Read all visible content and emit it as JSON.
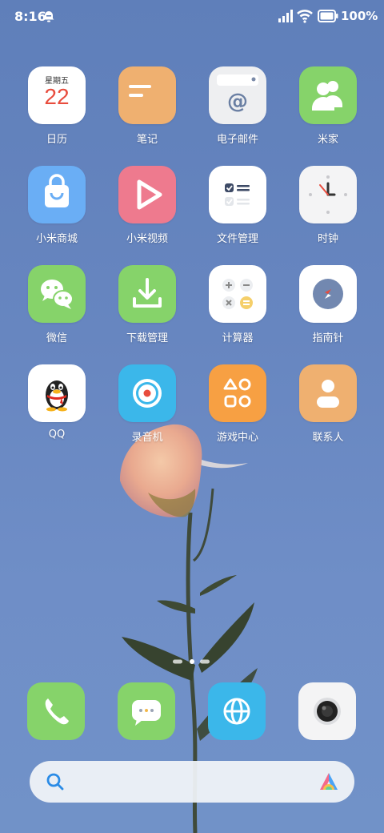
{
  "status_bar": {
    "time": "8:16",
    "battery": "100%",
    "battery_level": 1.0
  },
  "apps": [
    {
      "label": "日历",
      "icon": "calendar-icon",
      "weekday": "星期五",
      "day": "22"
    },
    {
      "label": "笔记",
      "icon": "notes-icon"
    },
    {
      "label": "电子邮件",
      "icon": "email-icon"
    },
    {
      "label": "米家",
      "icon": "mijia-icon"
    },
    {
      "label": "小米商城",
      "icon": "shopping-bag-icon"
    },
    {
      "label": "小米视频",
      "icon": "play-icon"
    },
    {
      "label": "文件管理",
      "icon": "file-manager-icon"
    },
    {
      "label": "时钟",
      "icon": "clock-icon"
    },
    {
      "label": "微信",
      "icon": "wechat-icon"
    },
    {
      "label": "下载管理",
      "icon": "download-icon"
    },
    {
      "label": "计算器",
      "icon": "calculator-icon"
    },
    {
      "label": "指南针",
      "icon": "compass-icon"
    },
    {
      "label": "QQ",
      "icon": "qq-penguin-icon"
    },
    {
      "label": "录音机",
      "icon": "recorder-icon"
    },
    {
      "label": "游戏中心",
      "icon": "game-center-icon"
    },
    {
      "label": "联系人",
      "icon": "contacts-icon"
    }
  ],
  "page_indicator": {
    "pages": 3,
    "current": 2
  },
  "dock": [
    {
      "icon": "phone-icon"
    },
    {
      "icon": "messages-icon"
    },
    {
      "icon": "browser-icon"
    },
    {
      "icon": "camera-icon"
    }
  ],
  "search_bar": {
    "icon": "search-icon",
    "assistant_icon": "assistant-icon"
  },
  "colors": {
    "wallpaper": "#6786c0",
    "green_tile": "#86d36a",
    "orange_tile": "#efb070",
    "blue_tile": "#6aaef5",
    "pink_tile": "#ee7a8e",
    "cyan_tile": "#3bb7ea",
    "calendar_red": "#e84c3d"
  }
}
